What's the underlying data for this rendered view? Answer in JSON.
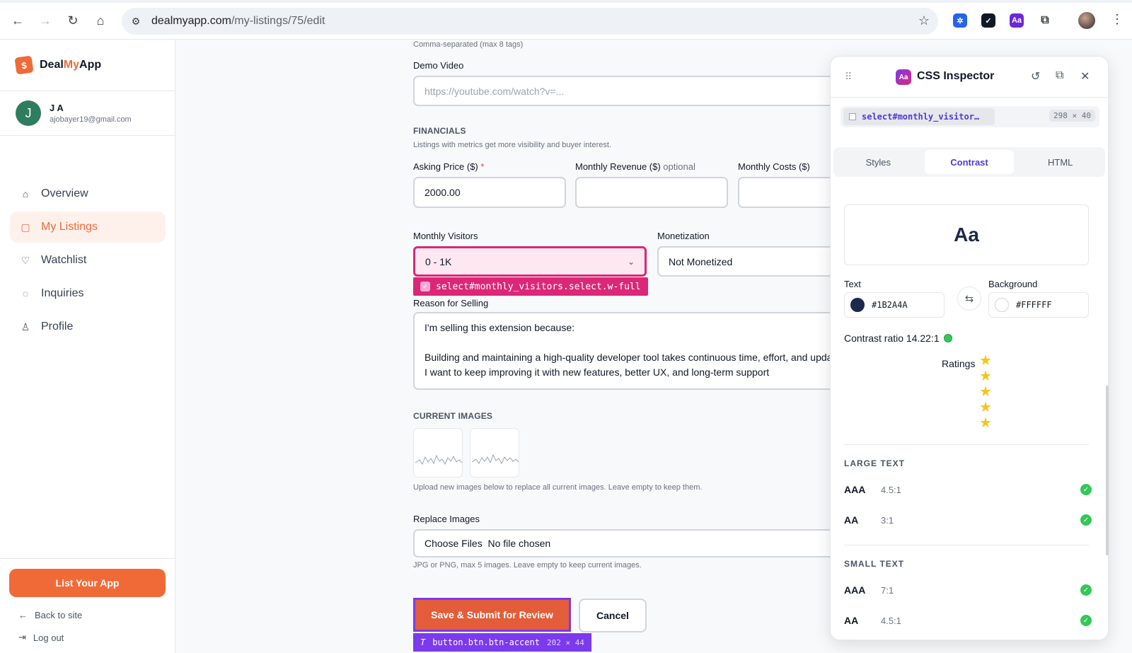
{
  "browser": {
    "url_host": "dealmyapp.com",
    "url_path": "/my-listings/75/edit"
  },
  "sidebar": {
    "brand_prefix": "Deal",
    "brand_accent": "My",
    "brand_suffix": "App",
    "user": {
      "initial": "J",
      "name": "J A",
      "email": "ajobayer19@gmail.com"
    },
    "items": [
      {
        "label": "Overview",
        "icon": "home-icon"
      },
      {
        "label": "My Listings",
        "icon": "bag-icon",
        "active": true
      },
      {
        "label": "Watchlist",
        "icon": "heart-icon"
      },
      {
        "label": "Inquiries",
        "icon": "chat-icon"
      },
      {
        "label": "Profile",
        "icon": "user-icon"
      }
    ],
    "list_button": "List Your App",
    "back_link": "Back to site",
    "logout_link": "Log out"
  },
  "form": {
    "tags_hint": "Comma-separated (max 8 tags)",
    "demo_video_label": "Demo Video",
    "demo_video_placeholder": "https://youtube.com/watch?v=...",
    "financials_title": "FINANCIALS",
    "financials_hint": "Listings with metrics get more visibility and buyer interest.",
    "asking_price_label": "Asking Price ($)",
    "asking_price_required": "*",
    "asking_price_value": "2000.00",
    "monthly_revenue_label": "Monthly Revenue ($)",
    "monthly_revenue_optional": "optional",
    "monthly_costs_label": "Monthly Costs ($)",
    "monthly_visitors_label": "Monthly Visitors",
    "monthly_visitors_value": "0 - 1K",
    "monetization_label": "Monetization",
    "monetization_value": "Not Monetized",
    "select_chip": "select#monthly_visitors.select.w-full",
    "reason_label": "Reason for Selling",
    "reason_text": "I'm selling this extension because:\n\nBuilding and maintaining a high-quality developer tool takes continuous time, effort, and updates\nI want to keep improving it with new features, better UX, and long-term support",
    "current_images_title": "CURRENT IMAGES",
    "current_images_hint": "Upload new images below to replace all current images. Leave empty to keep them.",
    "replace_images_label": "Replace Images",
    "replace_images_value": "Choose Files  No file chosen",
    "replace_images_hint": "JPG or PNG, max 5 images. Leave empty to keep current images.",
    "submit_button": "Save & Submit for Review",
    "cancel_button": "Cancel",
    "button_chip": "button.btn.btn-accent",
    "button_chip_dims": "202 × 44"
  },
  "inspector": {
    "title": "CSS Inspector",
    "badge": "Aa",
    "selector": "select#monthly_visitor…",
    "selector_dims": "298 × 40",
    "tabs": [
      "Styles",
      "Contrast",
      "HTML"
    ],
    "active_tab": "Contrast",
    "preview_text": "Aa",
    "text_label": "Text",
    "text_color": "#1B2A4A",
    "background_label": "Background",
    "background_color": "#FFFFFF",
    "contrast_label": "Contrast ratio 14.22:1",
    "ratings_label": "Ratings",
    "ratings_stars": 5,
    "large_text_title": "LARGE TEXT",
    "large_rows": [
      {
        "level": "AAA",
        "ratio": "4.5:1",
        "pass": true
      },
      {
        "level": "AA",
        "ratio": "3:1",
        "pass": true
      }
    ],
    "small_text_title": "SMALL TEXT",
    "small_rows": [
      {
        "level": "AAA",
        "ratio": "7:1",
        "pass": true
      },
      {
        "level": "AA",
        "ratio": "4.5:1",
        "pass": true
      }
    ]
  },
  "colors": {
    "accent": "#f06a38",
    "inspector_highlight": "#db2777",
    "button_highlight": "#7c3aed"
  }
}
